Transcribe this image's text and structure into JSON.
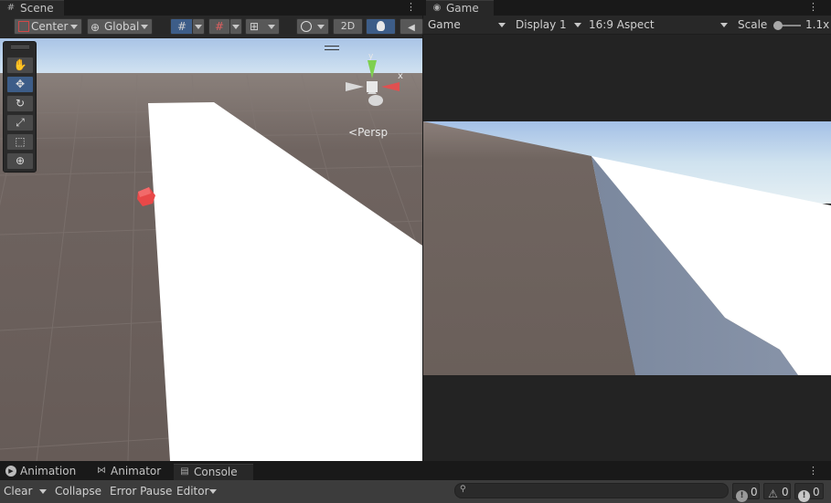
{
  "scene": {
    "tab_label": "Scene",
    "toolbar": {
      "pivot_label": "Center",
      "space_label": "Global",
      "mode_2d_label": "2D"
    },
    "tools": [
      "hand-tool",
      "move-tool",
      "rotate-tool",
      "scale-tool",
      "rect-tool",
      "transform-tool"
    ],
    "selected_tool": "move-tool",
    "gizmo": {
      "x_label": "x",
      "projection_label": "Persp"
    }
  },
  "game": {
    "tab_label": "Game",
    "toolbar": {
      "view_label": "Game",
      "display_label": "Display 1",
      "aspect_label": "16:9 Aspect",
      "scale_label": "Scale",
      "scale_value": "1.1x"
    }
  },
  "bottom": {
    "tabs": [
      {
        "label": "Animation",
        "icon": "play-circle-icon"
      },
      {
        "label": "Animator",
        "icon": "animator-icon"
      },
      {
        "label": "Console",
        "icon": "console-icon",
        "active": true
      }
    ],
    "console": {
      "clear_label": "Clear",
      "collapse_label": "Collapse",
      "error_pause_label": "Error Pause",
      "editor_label": "Editor",
      "log_count": "0",
      "warning_count": "0",
      "error_count": "0"
    }
  },
  "colors": {
    "panel_bg": "#282828",
    "toolbar_bg": "#3c3c3c",
    "selection_blue": "#3d5d88",
    "sky_top": "#a9c4e6",
    "ground": "#6e625d"
  }
}
